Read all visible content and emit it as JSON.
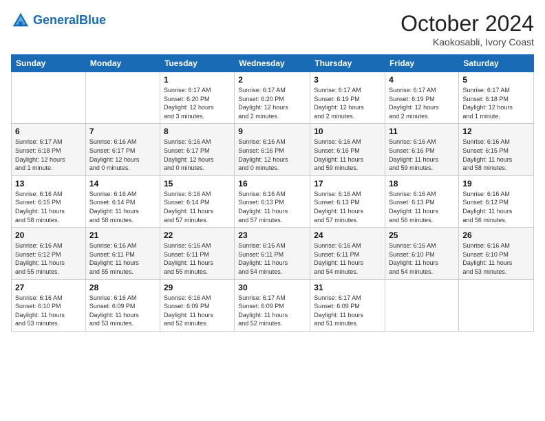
{
  "header": {
    "logo_line1": "General",
    "logo_line2": "Blue",
    "month_year": "October 2024",
    "location": "Kaokosabli, Ivory Coast"
  },
  "weekdays": [
    "Sunday",
    "Monday",
    "Tuesday",
    "Wednesday",
    "Thursday",
    "Friday",
    "Saturday"
  ],
  "weeks": [
    [
      {
        "day": "",
        "content": ""
      },
      {
        "day": "",
        "content": ""
      },
      {
        "day": "1",
        "content": "Sunrise: 6:17 AM\nSunset: 6:20 PM\nDaylight: 12 hours\nand 3 minutes."
      },
      {
        "day": "2",
        "content": "Sunrise: 6:17 AM\nSunset: 6:20 PM\nDaylight: 12 hours\nand 2 minutes."
      },
      {
        "day": "3",
        "content": "Sunrise: 6:17 AM\nSunset: 6:19 PM\nDaylight: 12 hours\nand 2 minutes."
      },
      {
        "day": "4",
        "content": "Sunrise: 6:17 AM\nSunset: 6:19 PM\nDaylight: 12 hours\nand 2 minutes."
      },
      {
        "day": "5",
        "content": "Sunrise: 6:17 AM\nSunset: 6:18 PM\nDaylight: 12 hours\nand 1 minute."
      }
    ],
    [
      {
        "day": "6",
        "content": "Sunrise: 6:17 AM\nSunset: 6:18 PM\nDaylight: 12 hours\nand 1 minute."
      },
      {
        "day": "7",
        "content": "Sunrise: 6:16 AM\nSunset: 6:17 PM\nDaylight: 12 hours\nand 0 minutes."
      },
      {
        "day": "8",
        "content": "Sunrise: 6:16 AM\nSunset: 6:17 PM\nDaylight: 12 hours\nand 0 minutes."
      },
      {
        "day": "9",
        "content": "Sunrise: 6:16 AM\nSunset: 6:16 PM\nDaylight: 12 hours\nand 0 minutes."
      },
      {
        "day": "10",
        "content": "Sunrise: 6:16 AM\nSunset: 6:16 PM\nDaylight: 11 hours\nand 59 minutes."
      },
      {
        "day": "11",
        "content": "Sunrise: 6:16 AM\nSunset: 6:16 PM\nDaylight: 11 hours\nand 59 minutes."
      },
      {
        "day": "12",
        "content": "Sunrise: 6:16 AM\nSunset: 6:15 PM\nDaylight: 11 hours\nand 58 minutes."
      }
    ],
    [
      {
        "day": "13",
        "content": "Sunrise: 6:16 AM\nSunset: 6:15 PM\nDaylight: 11 hours\nand 58 minutes."
      },
      {
        "day": "14",
        "content": "Sunrise: 6:16 AM\nSunset: 6:14 PM\nDaylight: 11 hours\nand 58 minutes."
      },
      {
        "day": "15",
        "content": "Sunrise: 6:16 AM\nSunset: 6:14 PM\nDaylight: 11 hours\nand 57 minutes."
      },
      {
        "day": "16",
        "content": "Sunrise: 6:16 AM\nSunset: 6:13 PM\nDaylight: 11 hours\nand 57 minutes."
      },
      {
        "day": "17",
        "content": "Sunrise: 6:16 AM\nSunset: 6:13 PM\nDaylight: 11 hours\nand 57 minutes."
      },
      {
        "day": "18",
        "content": "Sunrise: 6:16 AM\nSunset: 6:13 PM\nDaylight: 11 hours\nand 56 minutes."
      },
      {
        "day": "19",
        "content": "Sunrise: 6:16 AM\nSunset: 6:12 PM\nDaylight: 11 hours\nand 56 minutes."
      }
    ],
    [
      {
        "day": "20",
        "content": "Sunrise: 6:16 AM\nSunset: 6:12 PM\nDaylight: 11 hours\nand 55 minutes."
      },
      {
        "day": "21",
        "content": "Sunrise: 6:16 AM\nSunset: 6:11 PM\nDaylight: 11 hours\nand 55 minutes."
      },
      {
        "day": "22",
        "content": "Sunrise: 6:16 AM\nSunset: 6:11 PM\nDaylight: 11 hours\nand 55 minutes."
      },
      {
        "day": "23",
        "content": "Sunrise: 6:16 AM\nSunset: 6:11 PM\nDaylight: 11 hours\nand 54 minutes."
      },
      {
        "day": "24",
        "content": "Sunrise: 6:16 AM\nSunset: 6:11 PM\nDaylight: 11 hours\nand 54 minutes."
      },
      {
        "day": "25",
        "content": "Sunrise: 6:16 AM\nSunset: 6:10 PM\nDaylight: 11 hours\nand 54 minutes."
      },
      {
        "day": "26",
        "content": "Sunrise: 6:16 AM\nSunset: 6:10 PM\nDaylight: 11 hours\nand 53 minutes."
      }
    ],
    [
      {
        "day": "27",
        "content": "Sunrise: 6:16 AM\nSunset: 6:10 PM\nDaylight: 11 hours\nand 53 minutes."
      },
      {
        "day": "28",
        "content": "Sunrise: 6:16 AM\nSunset: 6:09 PM\nDaylight: 11 hours\nand 53 minutes."
      },
      {
        "day": "29",
        "content": "Sunrise: 6:16 AM\nSunset: 6:09 PM\nDaylight: 11 hours\nand 52 minutes."
      },
      {
        "day": "30",
        "content": "Sunrise: 6:17 AM\nSunset: 6:09 PM\nDaylight: 11 hours\nand 52 minutes."
      },
      {
        "day": "31",
        "content": "Sunrise: 6:17 AM\nSunset: 6:09 PM\nDaylight: 11 hours\nand 51 minutes."
      },
      {
        "day": "",
        "content": ""
      },
      {
        "day": "",
        "content": ""
      }
    ]
  ]
}
